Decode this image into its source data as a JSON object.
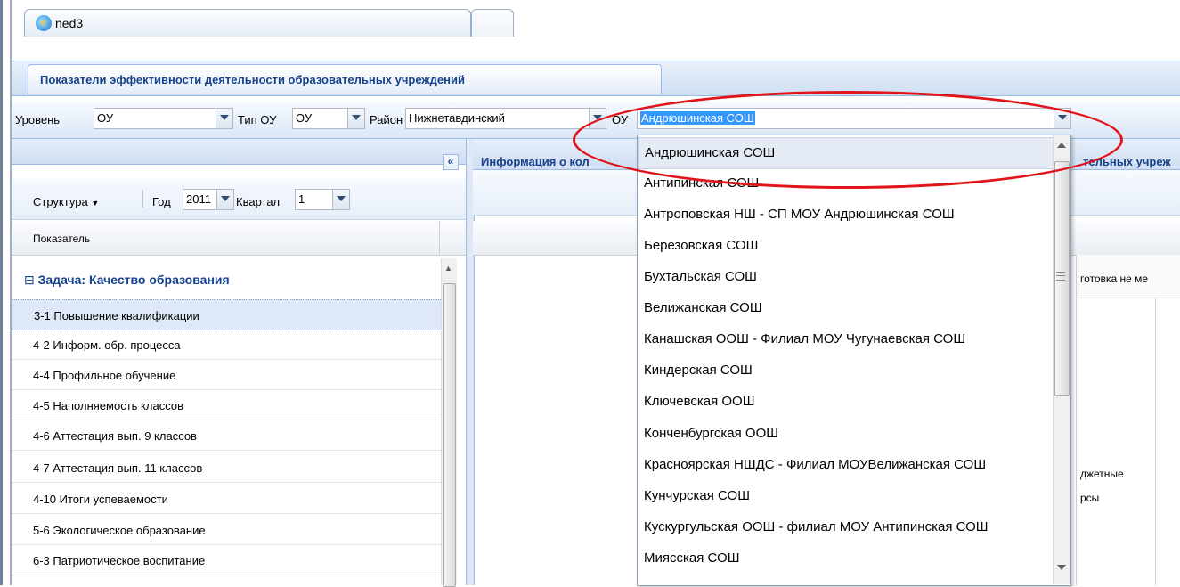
{
  "browser": {
    "tab_title": "ned3"
  },
  "app": {
    "title": "Показатели эффективности деятельности образовательных учреждений"
  },
  "filters": {
    "level_label": "Уровень",
    "level_value": "ОУ",
    "type_label": "Тип ОУ",
    "type_value": "ОУ",
    "district_label": "Район",
    "district_value": "Нижнетавдинский",
    "school_label": "ОУ",
    "school_value": "Андрюшинская СОШ"
  },
  "left_panel": {
    "collapse_icon": "«",
    "structure_label": "Структура",
    "year_label": "Год",
    "year_value": "2011",
    "quarter_label": "Квартал",
    "quarter_value": "1",
    "column_header": "Показатель",
    "group_label": "Задача: Качество образования",
    "rows": [
      "3-1 Повышение квалификации",
      "4-2 Информ. обр. процесса",
      "4-4 Профильное обучение",
      "4-5 Наполняемость классов",
      "4-6 Аттестация вып. 9 классов",
      "4-7 Аттестация вып. 11 классов",
      "4-10 Итоги успеваемости",
      "5-6 Экологическое образование",
      "6-3 Патриотическое воспитание"
    ]
  },
  "right_panel": {
    "title_left": "Информация о кол",
    "title_right": "тельных учреж",
    "cell_text": "готовка не ме",
    "text_a": "джетные",
    "text_b": "рсы"
  },
  "dropdown": {
    "items": [
      "Андрюшинская СОШ",
      "Антипинская СОШ",
      "Антроповская НШ - СП МОУ Андрюшинская СОШ",
      "Березовская СОШ",
      "Бухтальская СОШ",
      "Велижанская СОШ",
      "Канашская ООШ - Филиал МОУ Чугунаевская СОШ",
      "Киндерская СОШ",
      "Ключевская ООШ",
      "Конченбургская ООШ",
      "Красноярская НШДС - Филиал МОУВелижанская СОШ",
      "Кунчурская СОШ",
      "Кускургульская ООШ - филиал МОУ Антипинская СОШ",
      "Миясская СОШ"
    ]
  },
  "colors": {
    "accent": "#15428b",
    "annotation": "#e0141b",
    "selection": "#3399ff"
  }
}
